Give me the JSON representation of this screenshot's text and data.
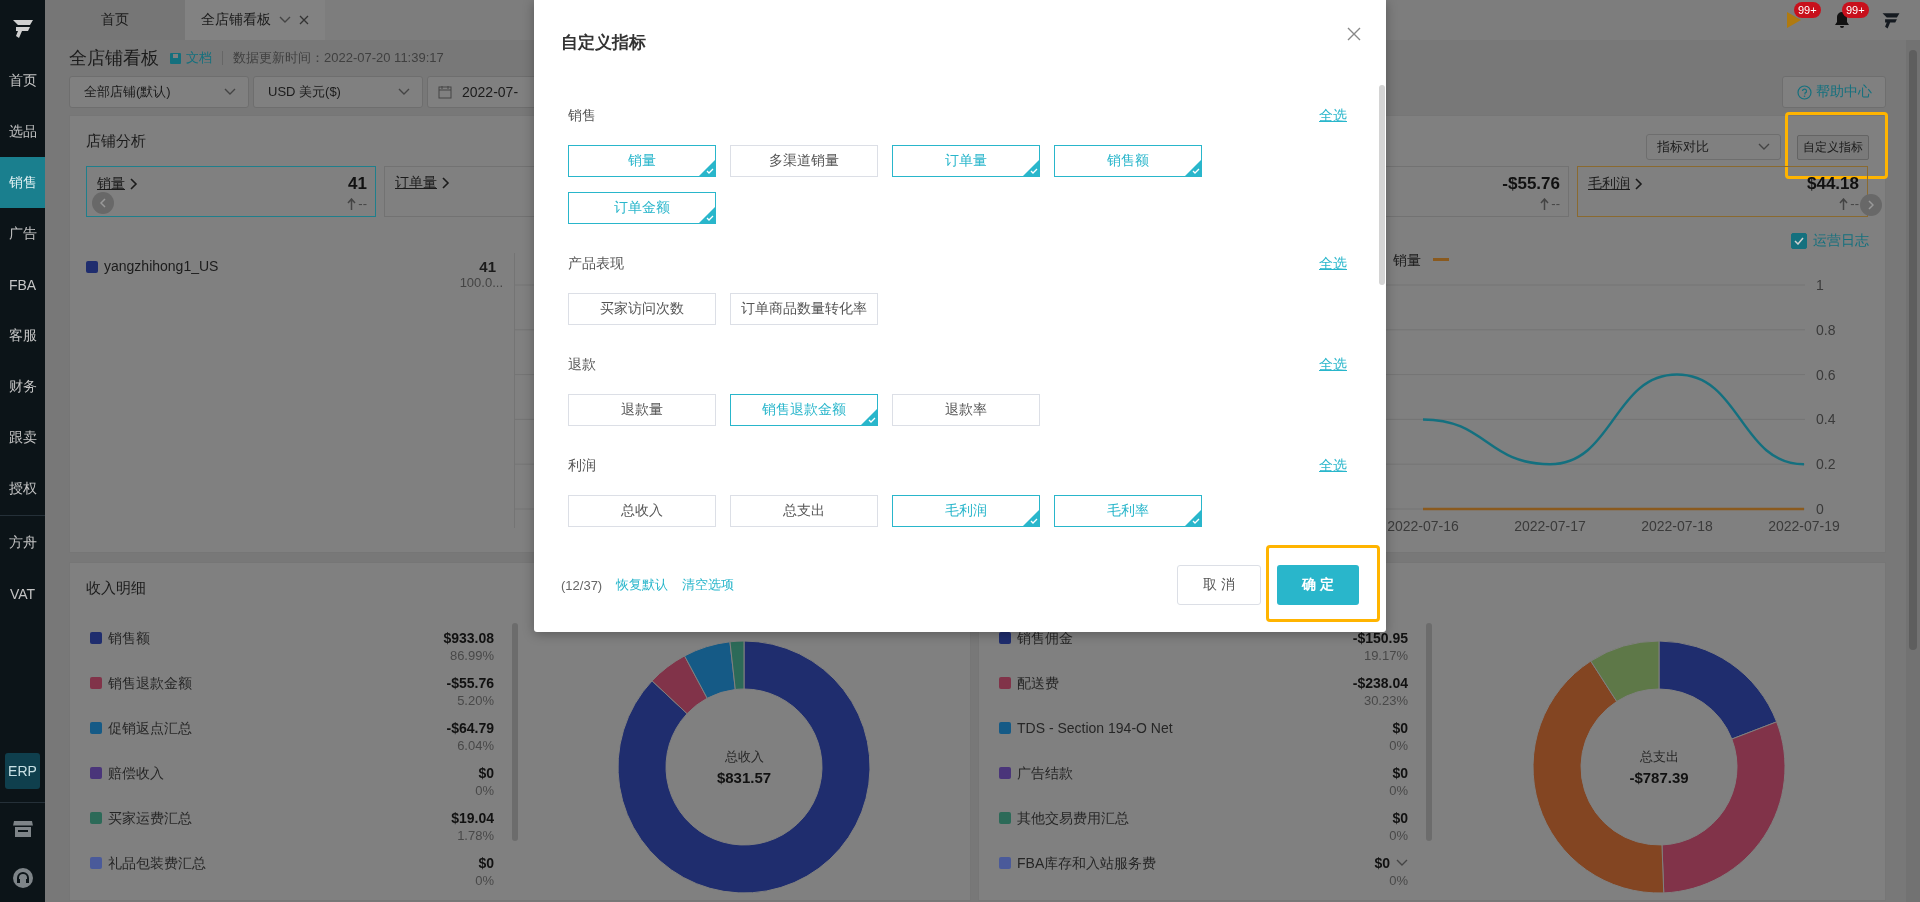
{
  "sidebar": {
    "main_items": [
      {
        "label": "首页",
        "selected": false
      },
      {
        "label": "选品",
        "selected": false
      },
      {
        "label": "销售",
        "selected": true
      },
      {
        "label": "广告",
        "selected": false
      },
      {
        "label": "FBA",
        "selected": false
      },
      {
        "label": "客服",
        "selected": false
      },
      {
        "label": "财务",
        "selected": false
      },
      {
        "label": "跟卖",
        "selected": false
      },
      {
        "label": "授权",
        "selected": false
      }
    ],
    "extra_items": [
      {
        "label": "方舟",
        "selected": false
      },
      {
        "label": "VAT",
        "selected": false
      }
    ],
    "erp_badge": "ERP"
  },
  "tabs": [
    {
      "label": "首页",
      "selected": false,
      "closable": false
    },
    {
      "label": "全店铺看板",
      "selected": true,
      "closable": true
    }
  ],
  "header": {
    "flag_badge": "99+",
    "bell_badge": "99+"
  },
  "page": {
    "title": "全店铺看板",
    "doc_link": "文档",
    "update_time": "数据更新时间：2022-07-20 11:39:17",
    "help_button": "帮助中心"
  },
  "filters": {
    "store": "全部店铺(默认)",
    "currency": "USD 美元($)",
    "date": "2022-07-"
  },
  "store_analysis": {
    "title": "店铺分析",
    "compare_select": "指标对比",
    "custom_metrics_button": {
      "label": "自定义指标",
      "highlighted": true
    },
    "metrics": [
      {
        "label": "销量",
        "value": "41",
        "change": "--",
        "color": "#1f7f8c"
      },
      {
        "label": "订单量"
      },
      {
        "value": "-$55.76",
        "change": "--"
      },
      {
        "label": "毛利润",
        "value": "$44.18",
        "change": "--",
        "color": "#8a6a30"
      }
    ],
    "ops_log": {
      "label": "运营日志",
      "checked": true
    },
    "stores": [
      {
        "name": "yangzhihong1_US",
        "value": "41",
        "share": "100.0...",
        "color": "#1f2d6e"
      }
    ],
    "chart_data": {
      "type": "line",
      "categories": [
        "2022-07-16",
        "2022-07-17",
        "2022-07-18",
        "2022-07-19"
      ],
      "series": [
        {
          "name": "销量",
          "color": "#8a5a1e",
          "values": [
            0,
            0,
            0,
            0
          ]
        },
        {
          "color": "#14707f",
          "values": [
            0.4,
            0.2,
            0.6,
            0.2
          ]
        }
      ],
      "ylim": [
        0,
        1
      ],
      "yticks": [
        0,
        0.2,
        0.4,
        0.6,
        0.8,
        1
      ],
      "grid": true
    }
  },
  "income": {
    "title": "收入明细",
    "rows": [
      {
        "amount": "$933.08",
        "share": "86.99%"
      },
      {
        "amount": "-$55.76",
        "share": "5.20%"
      },
      {
        "amount": "-$64.79",
        "share": "6.04%"
      },
      {
        "amount": "$0",
        "share": "0%"
      },
      {
        "amount": "$19.04",
        "share": "1.78%"
      },
      {
        "amount": "$0",
        "share": "0%"
      }
    ],
    "donut": {
      "label": "总收入",
      "total": "$831.57"
    },
    "chart_data": {
      "type": "donut",
      "categories": [
        "销售额",
        "销售退款金额",
        "促销返点汇总",
        "赔偿收入",
        "买家运费汇总",
        "礼品包装费汇总"
      ],
      "values": [
        86.99,
        5.2,
        6.04,
        0,
        1.78,
        0
      ],
      "colors": [
        "#1f2d6e",
        "#813349",
        "#155a86",
        "#4a357a",
        "#2c6a58",
        "#4a5a9a"
      ]
    }
  },
  "expense": {
    "rows": [
      {
        "label": "销售佣金",
        "amount": "-$150.95",
        "share": "19.17%",
        "color": "#1f2d6e",
        "kind": "item"
      },
      {
        "label": "配送费",
        "amount": "-$238.04",
        "share": "30.23%",
        "color": "#813349",
        "kind": "item"
      },
      {
        "label": "TDS - Section 194-O Net",
        "amount": "$0",
        "share": "0%",
        "color": "#155a86",
        "kind": "item"
      },
      {
        "label": "广告结款",
        "amount": "$0",
        "share": "0%",
        "color": "#4a357a",
        "kind": "item"
      },
      {
        "label": "其他交易费用汇总",
        "amount": "$0",
        "share": "0%",
        "color": "#2c6a58",
        "kind": "item"
      },
      {
        "label": "FBA库存和入站服务费",
        "amount": "$0",
        "share": "0%",
        "color": "#4a5a9a",
        "kind": "group"
      }
    ],
    "donut": {
      "label": "总支出",
      "total": "-$787.39"
    },
    "other_slices": [
      {
        "color": "#834522"
      },
      {
        "color": "#5e7848"
      }
    ]
  },
  "modal": {
    "title": "自定义指标",
    "sections": [
      {
        "title": "销售",
        "select_all": "全选",
        "options": [
          {
            "label": "销量",
            "selected": true
          },
          {
            "label": "多渠道销量",
            "selected": false
          },
          {
            "label": "订单量",
            "selected": true
          },
          {
            "label": "销售额",
            "selected": true
          },
          {
            "label": "订单金额",
            "selected": true
          }
        ]
      },
      {
        "title": "产品表现",
        "select_all": "全选",
        "options": [
          {
            "label": "买家访问次数",
            "selected": false
          },
          {
            "label": "订单商品数量转化率",
            "selected": false
          }
        ]
      },
      {
        "title": "退款",
        "select_all": "全选",
        "options": [
          {
            "label": "退款量",
            "selected": false
          },
          {
            "label": "销售退款金额",
            "selected": true
          },
          {
            "label": "退款率",
            "selected": false
          }
        ]
      },
      {
        "title": "利润",
        "select_all": "全选",
        "options": [
          {
            "label": "总收入",
            "selected": false
          },
          {
            "label": "总支出",
            "selected": false
          },
          {
            "label": "毛利润",
            "selected": true
          },
          {
            "label": "毛利率",
            "selected": true
          }
        ]
      }
    ],
    "count": "(12/37)",
    "restore_link": "恢复默认",
    "clear_link": "清空选项",
    "cancel_button": {
      "label": "取 消"
    },
    "confirm_button": {
      "label": "确 定",
      "highlighted": true
    }
  }
}
